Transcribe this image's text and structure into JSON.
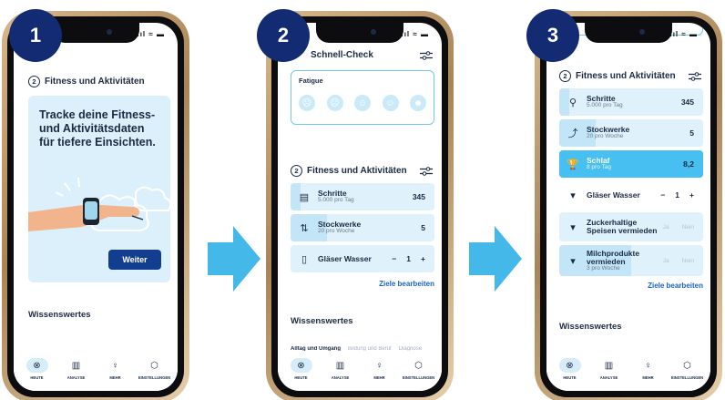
{
  "steps": [
    "1",
    "2",
    "3"
  ],
  "nav": {
    "items": [
      {
        "label": "HEUTE",
        "icon": "today-icon"
      },
      {
        "label": "ANALYSE",
        "icon": "analysis-icon"
      },
      {
        "label": "MEHR",
        "icon": "more-icon"
      },
      {
        "label": "EINSTELLUNGEN",
        "icon": "settings-icon"
      }
    ]
  },
  "phone1": {
    "section_num": "2",
    "section_title": "Fitness und Aktivitäten",
    "hero_text": "Tracke deine Fitness- und Aktivitätsdaten für tiefere Einsichten.",
    "next_button": "Weiter",
    "wissenswertes": "Wissenswertes"
  },
  "phone2": {
    "check_title": "Schnell-Check",
    "fatigue_label": "Fatigue",
    "section_num": "2",
    "section_title": "Fitness und Aktivitäten",
    "rows": [
      {
        "title": "Schritte",
        "sub": "5.000 pro Tag",
        "value": "345",
        "icon": "steps-icon",
        "progress": 0.07
      },
      {
        "title": "Stockwerke",
        "sub": "20 pro Woche",
        "value": "5",
        "icon": "stairs-icon",
        "progress": 0.25
      },
      {
        "title": "Gläser Wasser",
        "minus": "−",
        "value": "1",
        "plus": "+",
        "icon": "water-glass-icon"
      }
    ],
    "edit_goals": "Ziele bearbeiten",
    "wissenswertes": "Wissenswertes",
    "tabs": [
      "Alltag und Umgang",
      "Bildung und Beruf",
      "Diagnose"
    ]
  },
  "phone3": {
    "section_num": "2",
    "section_title": "Fitness und Aktivitäten",
    "rows": [
      {
        "title": "Schritte",
        "sub": "5.000 pro Tag",
        "value": "345",
        "icon": "steps-icon",
        "progress": 0.07
      },
      {
        "title": "Stockwerke",
        "sub": "20 pro Woche",
        "value": "5",
        "icon": "stairs-icon",
        "progress": 0.25
      },
      {
        "title": "Schlaf",
        "sub": "8 pro Tag",
        "value": "8,2",
        "icon": "trophy-icon",
        "progress": 1.0
      },
      {
        "title": "Gläser Wasser",
        "minus": "−",
        "value": "1",
        "plus": "+",
        "icon": "water-glass-icon"
      },
      {
        "title": "Zuckerhaltige Speisen vermieden",
        "yes": "Ja",
        "no": "Nein",
        "icon": "cup-icon"
      },
      {
        "title": "Milchprodukte vermieden",
        "sub": "3 pro Woche",
        "yes": "Ja",
        "no": "Nein",
        "icon": "cup-icon",
        "progress": 0.5
      }
    ],
    "edit_goals": "Ziele bearbeiten",
    "wissenswertes": "Wissenswertes"
  },
  "colors": {
    "badge": "#132b73",
    "arrow": "#45b8ea",
    "row": "#dff1fb",
    "row_fill": "#c2e6f7",
    "highlight": "#47bff0",
    "button": "#123e8f",
    "link": "#1c63c4"
  }
}
